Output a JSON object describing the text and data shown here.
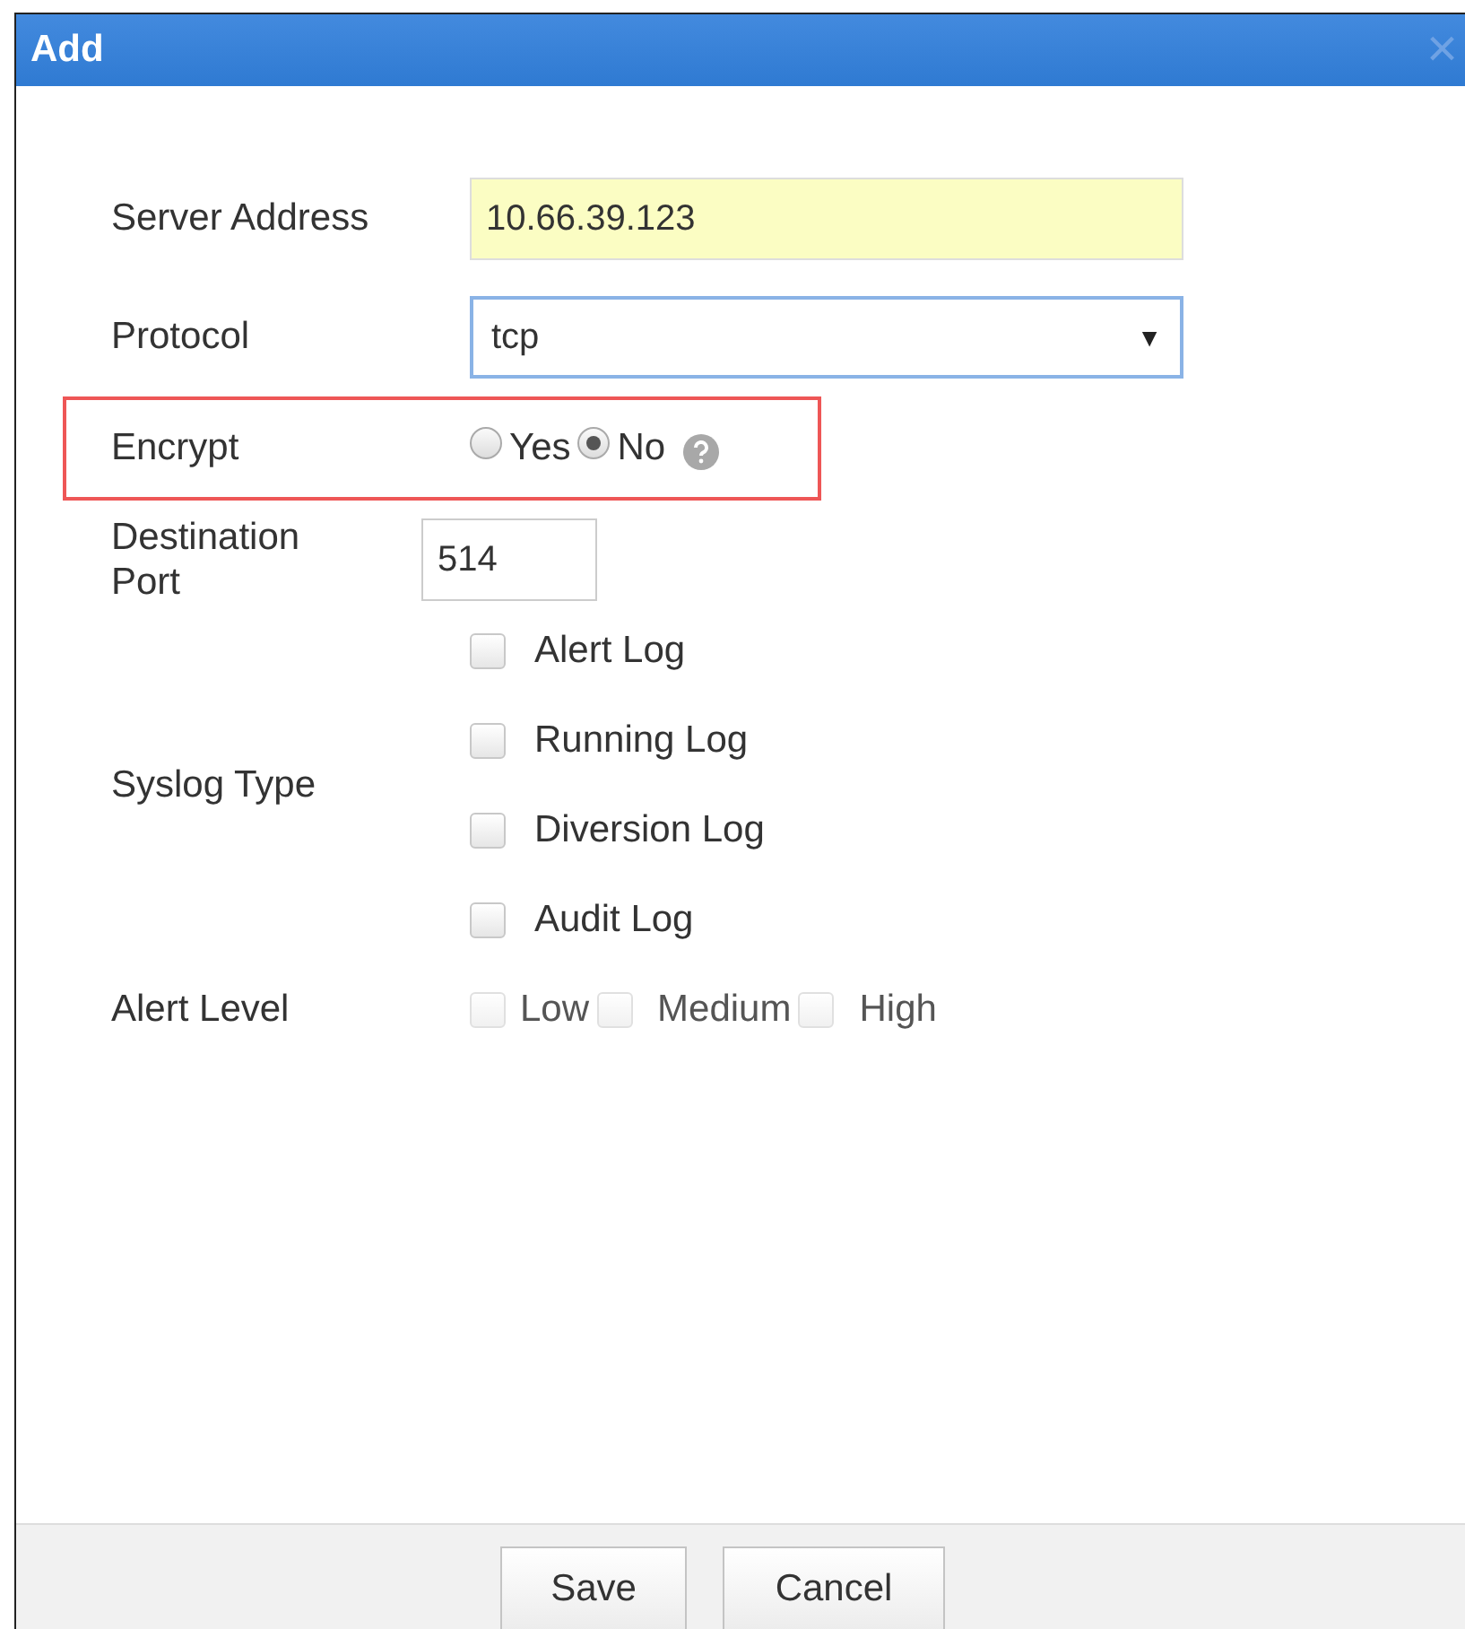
{
  "window": {
    "title": "Add",
    "close": "×"
  },
  "server_address": {
    "label": "Server Address",
    "value": "10.66.39.123"
  },
  "protocol": {
    "label": "Protocol",
    "value": "tcp",
    "arrow": "▼"
  },
  "encrypt": {
    "label": "Encrypt",
    "highlighted": true,
    "options": [
      {
        "label": "Yes",
        "selected": false
      },
      {
        "label": "No",
        "selected": true
      }
    ]
  },
  "destination_port": {
    "label": "Destination Port",
    "value": "514"
  },
  "syslog_type": {
    "label": "Syslog Type",
    "options": [
      {
        "label": "Alert Log",
        "checked": false
      },
      {
        "label": "Running Log",
        "checked": false
      },
      {
        "label": "Diversion Log",
        "checked": false
      },
      {
        "label": "Audit Log",
        "checked": false
      }
    ]
  },
  "alert_level": {
    "label": "Alert Level",
    "options": [
      {
        "label": "Low",
        "checked": false,
        "disabled": true
      },
      {
        "label": "Medium",
        "checked": false,
        "disabled": true
      },
      {
        "label": "High",
        "checked": false,
        "disabled": true
      }
    ]
  },
  "buttons": [
    "Save",
    "Cancel"
  ]
}
